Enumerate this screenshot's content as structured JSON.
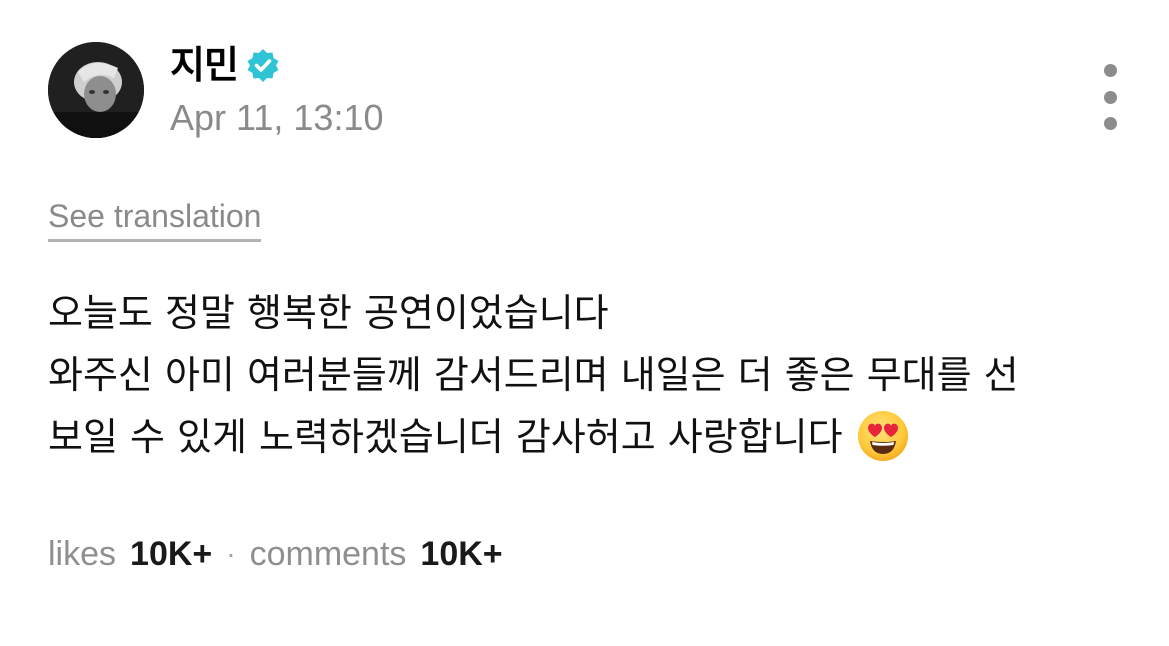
{
  "post": {
    "author": {
      "name": "지민",
      "verified_color": "#2ec4d6"
    },
    "timestamp": "Apr 11, 13:10",
    "see_translation": "See translation",
    "body_lines": [
      "오늘도 정말 행복한 공연이었습니다",
      "와주신 아미 여러분들께 감서드리며 내일은 더 좋은 무대를 선",
      "보일 수 있게 노력하겠습니더 감사허고 사랑합니다"
    ],
    "emoji": "smiling-face-with-heart-eyes",
    "stats": {
      "likes_label": "likes",
      "likes_value": "10K+",
      "separator": "·",
      "comments_label": "comments",
      "comments_value": "10K+"
    }
  }
}
